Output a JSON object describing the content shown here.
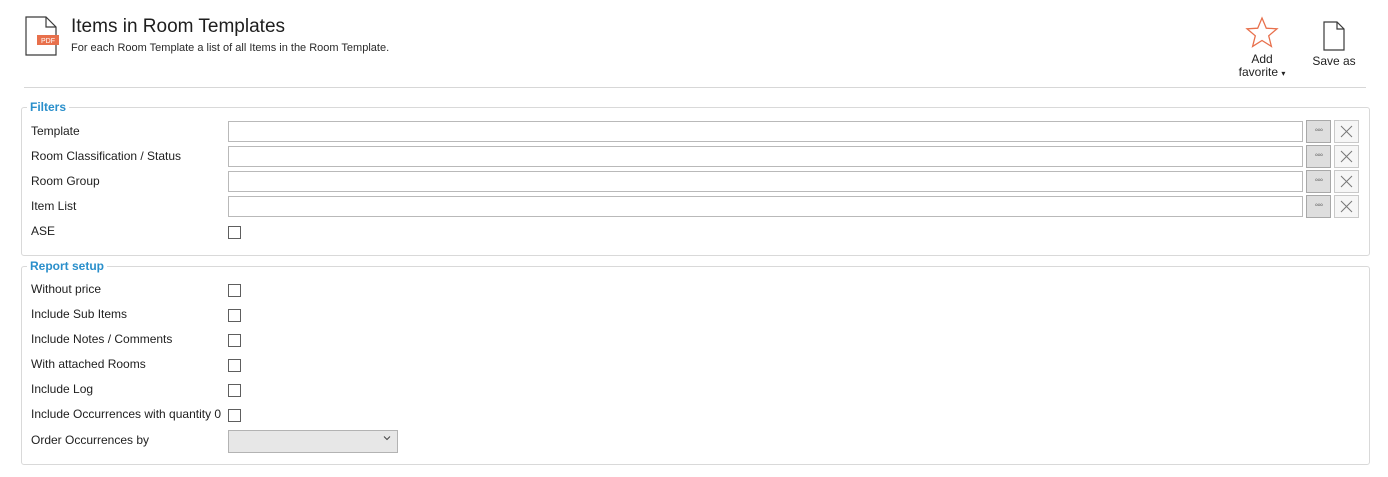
{
  "header": {
    "title": "Items in Room Templates",
    "subtitle": "For each Room Template a list of all Items in the Room Template.",
    "pdf_label": "PDF",
    "add_favorite_line1": "Add",
    "add_favorite_line2": "favorite",
    "save_as_label": "Save as"
  },
  "filters": {
    "title": "Filters",
    "fields": [
      {
        "label": "Template",
        "value": ""
      },
      {
        "label": "Room Classification / Status",
        "value": ""
      },
      {
        "label": "Room Group",
        "value": ""
      },
      {
        "label": "Item List",
        "value": ""
      }
    ],
    "ase": {
      "label": "ASE",
      "checked": false
    }
  },
  "report_setup": {
    "title": "Report setup",
    "options": [
      {
        "label": "Without price",
        "checked": false
      },
      {
        "label": "Include Sub Items",
        "checked": false
      },
      {
        "label": "Include Notes / Comments",
        "checked": false
      },
      {
        "label": "With attached Rooms",
        "checked": false
      },
      {
        "label": "Include Log",
        "checked": false
      },
      {
        "label": "Include Occurrences with quantity 0",
        "checked": false
      }
    ],
    "order_by": {
      "label": "Order Occurrences by",
      "value": ""
    }
  },
  "icons": {
    "pdf": "pdf-file-icon",
    "favorite": "star-outline-icon",
    "save": "document-icon",
    "browse": "ellipsis-icon",
    "clear": "close-icon",
    "dropdown": "chevron-down-icon"
  },
  "colors": {
    "accent": "#2a8fcb",
    "star": "#e8704c",
    "pdf_badge": "#e8704c"
  }
}
